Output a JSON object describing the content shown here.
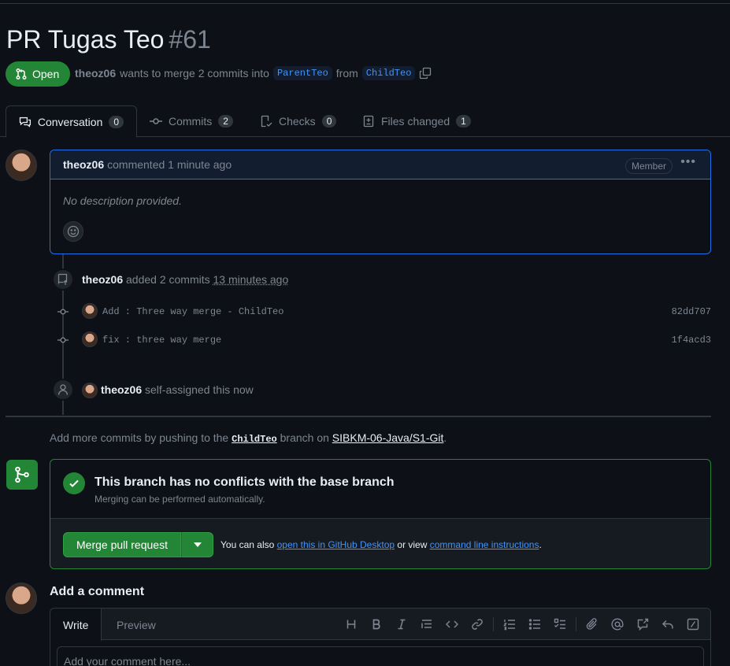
{
  "pr": {
    "title": "PR Tugas Teo",
    "number": "#61",
    "state": "Open",
    "author": "theoz06",
    "wants_text": "wants to merge 2 commits into",
    "base_branch": "ParentTeo",
    "from_text": "from",
    "head_branch": "ChildTeo"
  },
  "tabs": [
    {
      "label": "Conversation",
      "count": "0"
    },
    {
      "label": "Commits",
      "count": "2"
    },
    {
      "label": "Checks",
      "count": "0"
    },
    {
      "label": "Files changed",
      "count": "1"
    }
  ],
  "comment": {
    "author": "theoz06",
    "action": "commented 1 minute ago",
    "role": "Member",
    "body": "No description provided."
  },
  "timeline": {
    "commits_author": "theoz06",
    "commits_action": "added 2 commits",
    "commits_time": "13 minutes ago",
    "commits": [
      {
        "message": "Add : Three way merge - ChildTeo",
        "sha": "82dd707"
      },
      {
        "message": "fix : three way merge",
        "sha": "1f4acd3"
      }
    ],
    "assign_author": "theoz06",
    "assign_action": "self-assigned this now"
  },
  "hint": {
    "prefix": "Add more commits by pushing to the",
    "branch": "ChildTeo",
    "middle": "branch on",
    "repo": "SIBKM-06-Java/S1-Git",
    "suffix": "."
  },
  "merge": {
    "title": "This branch has no conflicts with the base branch",
    "subtitle": "Merging can be performed automatically.",
    "button": "Merge pull request",
    "alt_prefix": "You can also",
    "alt_link1": "open this in GitHub Desktop",
    "alt_middle": "or view",
    "alt_link2": "command line instructions",
    "alt_suffix": "."
  },
  "add_comment": {
    "title": "Add a comment",
    "tab_write": "Write",
    "tab_preview": "Preview",
    "placeholder": "Add your comment here..."
  },
  "colors": {
    "accent_green": "#238636",
    "accent_blue": "#1f6feb",
    "link_blue": "#4493f8",
    "background": "#0d1117"
  }
}
